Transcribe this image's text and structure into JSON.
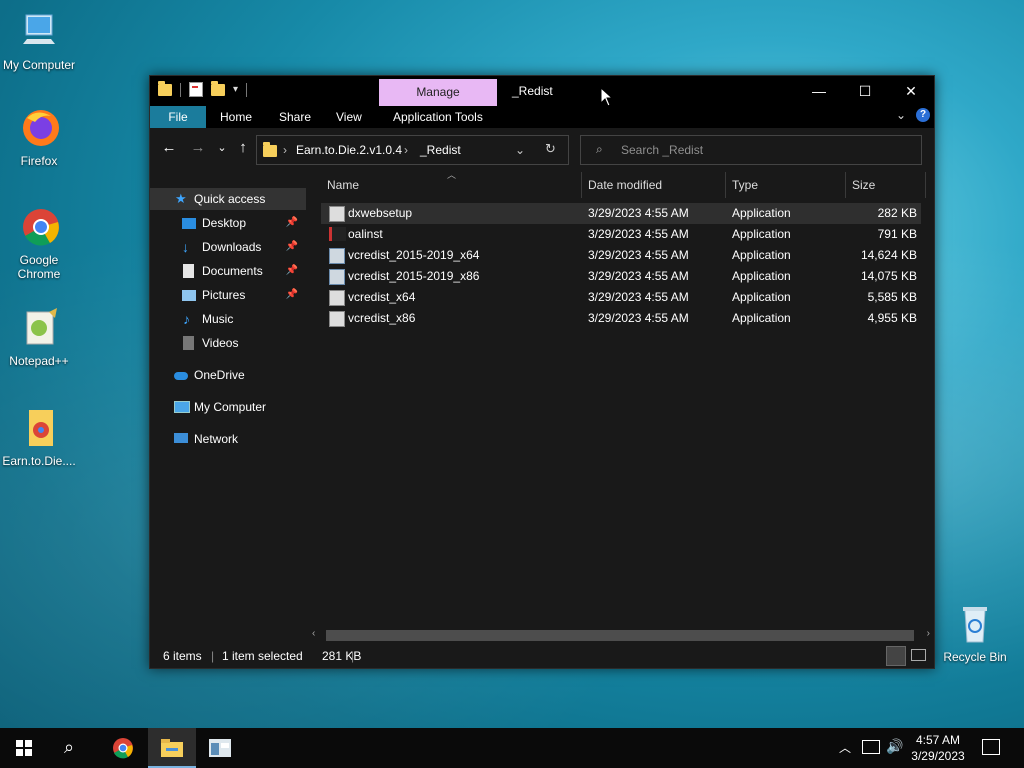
{
  "desktop": {
    "icons": [
      {
        "label": "My Computer"
      },
      {
        "label": "Firefox"
      },
      {
        "label": "Google Chrome"
      },
      {
        "label": "Notepad++"
      },
      {
        "label": "Earn.to.Die...."
      },
      {
        "label": "Recycle Bin"
      }
    ]
  },
  "window": {
    "manage_label": "Manage",
    "title": "_Redist",
    "controls": {
      "minimize": "—",
      "maximize": "☐",
      "close": "✕"
    },
    "ribbon": {
      "tabs": [
        "File",
        "Home",
        "Share",
        "View",
        "Application Tools"
      ]
    },
    "address": {
      "crumbs": [
        "Earn.to.Die.2.v1.0.4",
        "_Redist"
      ]
    },
    "search": {
      "placeholder": "Search _Redist"
    },
    "sidebar": {
      "items": [
        {
          "label": "Quick access"
        },
        {
          "label": "Desktop"
        },
        {
          "label": "Downloads"
        },
        {
          "label": "Documents"
        },
        {
          "label": "Pictures"
        },
        {
          "label": "Music"
        },
        {
          "label": "Videos"
        },
        {
          "label": "OneDrive"
        },
        {
          "label": "My Computer"
        },
        {
          "label": "Network"
        }
      ]
    },
    "columns": [
      "Name",
      "Date modified",
      "Type",
      "Size"
    ],
    "files": [
      {
        "name": "dxwebsetup",
        "date": "3/29/2023 4:55 AM",
        "type": "Application",
        "size": "282 KB"
      },
      {
        "name": "oalinst",
        "date": "3/29/2023 4:55 AM",
        "type": "Application",
        "size": "791 KB"
      },
      {
        "name": "vcredist_2015-2019_x64",
        "date": "3/29/2023 4:55 AM",
        "type": "Application",
        "size": "14,624 KB"
      },
      {
        "name": "vcredist_2015-2019_x86",
        "date": "3/29/2023 4:55 AM",
        "type": "Application",
        "size": "14,075 KB"
      },
      {
        "name": "vcredist_x64",
        "date": "3/29/2023 4:55 AM",
        "type": "Application",
        "size": "5,585 KB"
      },
      {
        "name": "vcredist_x86",
        "date": "3/29/2023 4:55 AM",
        "type": "Application",
        "size": "4,955 KB"
      }
    ],
    "status": {
      "count": "6 items",
      "selected": "1 item selected",
      "size": "281 KB"
    }
  },
  "taskbar": {
    "time": "4:57 AM",
    "date": "3/29/2023"
  },
  "colors": {
    "accent": "#1b7c9c",
    "manage_tab": "#e8b8f4",
    "folder": "#f7cf5b"
  }
}
